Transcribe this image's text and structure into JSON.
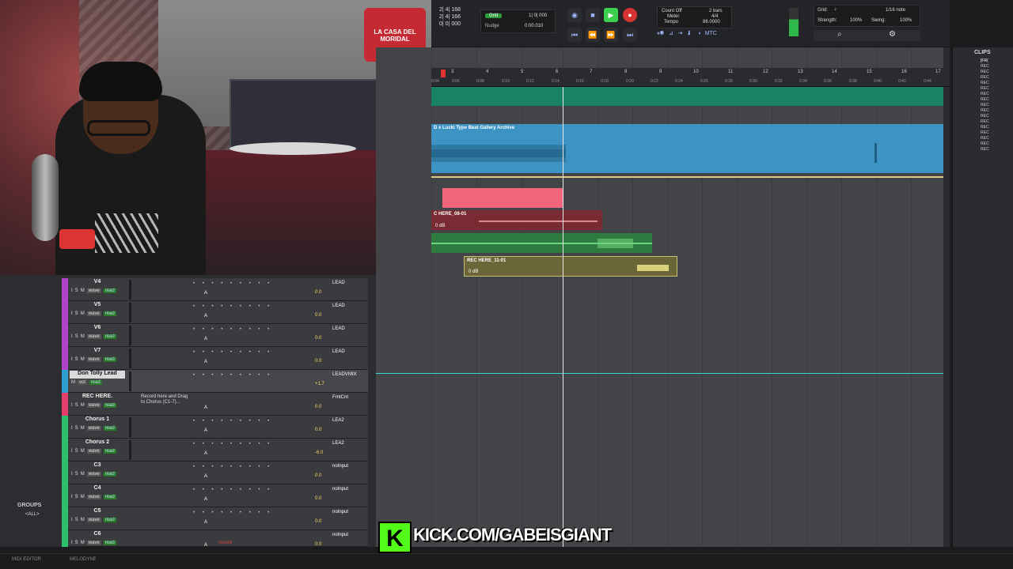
{
  "transport": {
    "counter_lines": [
      "2| 4| 168",
      "2| 4| 166",
      "0| 0| 000"
    ],
    "grid_label": "Grid",
    "grid_value": "1| 0| 000",
    "nudge_label": "Nudge",
    "nudge_value": "0:00.010",
    "count_off_label": "Count Off",
    "count_off_value": "2 bars",
    "meter_label": "Meter",
    "meter_value": "4/4",
    "tempo_label": "Tempo",
    "tempo_value": "86.0000",
    "mtc_label": "MTC"
  },
  "grid_panel": {
    "grid_label": "Grid:",
    "grid_value": "1/16 note",
    "strength_label": "Strength:",
    "strength_value": "100%",
    "swing_label": "Swing:",
    "swing_value": "100%"
  },
  "ruler": {
    "bars": [
      "3",
      "4",
      "5",
      "6",
      "7",
      "8",
      "9",
      "10",
      "11",
      "12",
      "13",
      "14",
      "15",
      "16",
      "17"
    ],
    "times": [
      "0:04",
      "0:06",
      "0:08",
      "0:10",
      "0:12",
      "0:14",
      "0:16",
      "0:18",
      "0:20",
      "0:22",
      "0:24",
      "0:26",
      "0:28",
      "0:30",
      "0:32",
      "0:34",
      "0:36",
      "0:38",
      "0:40",
      "0:42",
      "0:44"
    ]
  },
  "clips": {
    "beat_clip_name": "D x Lucki Type Beat Gallery Archive",
    "rec08_name": "C HERE_08-01",
    "rec08_db": "0 dB",
    "rec11_name": "REC HERE_11-01",
    "rec11_db": "0 dB"
  },
  "clips_panel": {
    "title": "CLIPS",
    "first_item": "[FR(",
    "items": [
      "REC",
      "REC",
      "REC",
      "REC",
      "REC",
      "REC",
      "REC",
      "REC",
      "REC",
      "REC",
      "REC",
      "REC",
      "REC",
      "REC",
      "REC",
      "REC"
    ]
  },
  "tracks": [
    {
      "name": "V4",
      "io": "LEAD",
      "vol": "0.0",
      "color": "#b044cc"
    },
    {
      "name": "V5",
      "io": "LEAD",
      "vol": "0.0",
      "color": "#b044cc"
    },
    {
      "name": "V6",
      "io": "LEAD",
      "vol": "0.0",
      "color": "#b044cc"
    },
    {
      "name": "V7",
      "io": "LEAD",
      "vol": "0.0",
      "color": "#b044cc"
    },
    {
      "name": "Don Tolly Lead",
      "io": "LEADV",
      "vol": "+1.7",
      "color": "#2f9fd0"
    },
    {
      "name": "REC HERE.",
      "io": "FrntCnt",
      "vol": "0.0",
      "color": "#e0406b"
    },
    {
      "name": "Chorus 1",
      "io": "LEA2",
      "vol": "0.0",
      "color": "#2fbf6a"
    },
    {
      "name": "Chorus 2",
      "io": "LEA2",
      "vol": "-6.0",
      "color": "#2fbf6a"
    },
    {
      "name": "C3",
      "io": "noInput",
      "vol": "0.0",
      "color": "#2fbf6a"
    },
    {
      "name": "C4",
      "io": "noInput",
      "vol": "0.0",
      "color": "#2fbf6a"
    },
    {
      "name": "C5",
      "io": "noInput",
      "vol": "0.0",
      "color": "#2fbf6a"
    },
    {
      "name": "C6",
      "io": "noInput",
      "vol": "0.0",
      "color": "#2fbf6a"
    }
  ],
  "track_labels": {
    "i": "I",
    "s": "S",
    "m": "M",
    "wave": "wave",
    "read": "read",
    "vol": "vol",
    "a": "A",
    "mix": "MIX",
    "rec_comment": "Record here and Drag to Chorus (C1-7)...",
    "record_label": "record",
    "dots": "• • • • • • • • •"
  },
  "groups": {
    "title": "GROUPS",
    "all_label": "<ALL>"
  },
  "bottom_tabs": [
    "MIDI EDITOR",
    "MELODYNE"
  ],
  "overlay": {
    "kick_text": "KICK.COM/GABEISGIANT",
    "kick_logo": "K"
  },
  "webcam": {
    "flag_text": "LA CASA DEL MORIDAL"
  }
}
